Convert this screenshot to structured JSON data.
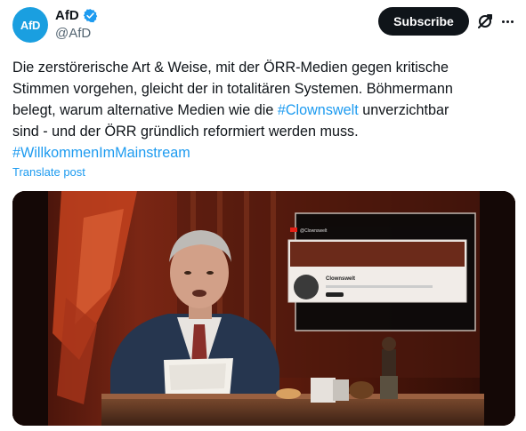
{
  "author": {
    "display_name": "AfD",
    "handle": "@AfD",
    "avatar_text": "AfD",
    "verified": true
  },
  "actions": {
    "subscribe_label": "Subscribe",
    "grok_icon": "grok-icon",
    "more_icon": "more-icon"
  },
  "post": {
    "line1": "Die zerstörerische Art & Weise, mit der ÖRR-Medien gegen kritische",
    "line2": "Stimmen vorgehen, gleicht der in totalitären Systemen. Böhmermann",
    "line3_pre": "belegt, warum alternative Medien wie die ",
    "line3_tag": "#Clownswelt",
    "line3_post": " unverzichtbar",
    "line4": "sind - und der ÖRR gründlich reformiert werden muss.",
    "line5_tag": "#WillkommenImMainstream",
    "translate_label": "Translate post"
  },
  "media": {
    "screen_channel_label": "Clownswelt",
    "screen_header_label": "@Clownswelt"
  },
  "colors": {
    "text": "#0f1419",
    "secondary": "#536471",
    "link": "#1d9bf0",
    "button": "#0f1419",
    "verified": "#1d9bf0",
    "avatar": "#1a9fe0"
  }
}
